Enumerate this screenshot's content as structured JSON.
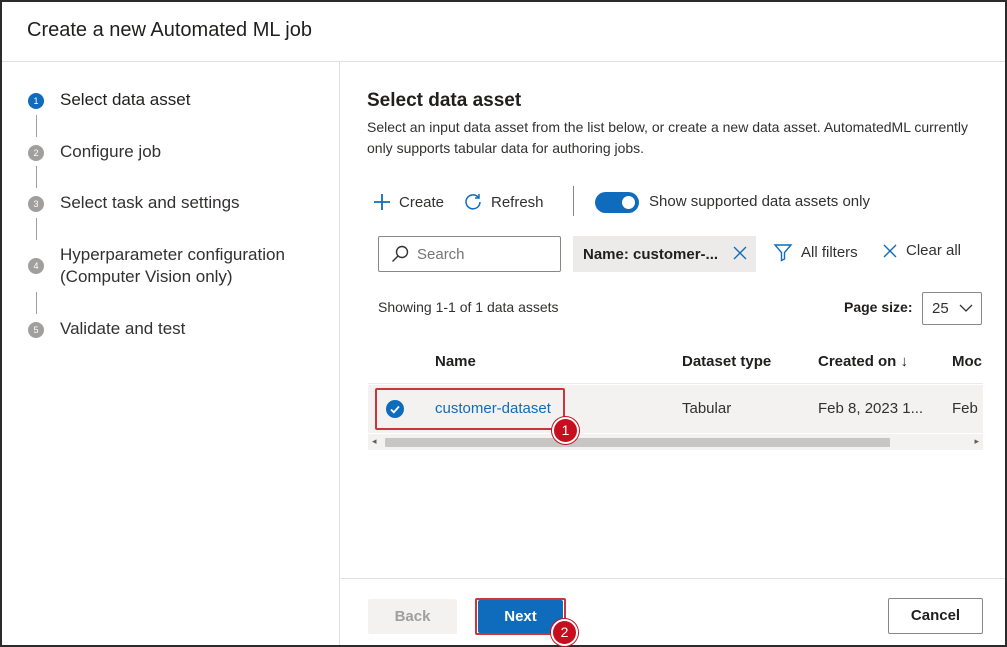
{
  "dialog": {
    "title": "Create a new Automated ML job"
  },
  "steps": [
    {
      "number": "1",
      "label": "Select data asset",
      "active": true
    },
    {
      "number": "2",
      "label": "Configure job"
    },
    {
      "number": "3",
      "label": "Select task and settings"
    },
    {
      "number": "4",
      "label": "Hyperparameter configuration",
      "label2": "(Computer Vision only)"
    },
    {
      "number": "5",
      "label": "Validate and test"
    }
  ],
  "main": {
    "title": "Select data asset",
    "description": "Select an input data asset from the list below, or create a new data asset. AutomatedML currently only supports tabular data for authoring jobs."
  },
  "toolbar": {
    "create_label": "Create",
    "refresh_label": "Refresh",
    "toggle_label": "Show supported data assets only",
    "toggle_on": true
  },
  "filters": {
    "search_placeholder": "Search",
    "chip_label": "Name: customer-...",
    "all_filters_label": "All filters",
    "clear_all_label": "Clear all"
  },
  "listing": {
    "showing_text": "Showing 1-1 of 1 data assets",
    "page_size_label": "Page size:",
    "page_size_value": "25"
  },
  "grid": {
    "columns": [
      "Name",
      "Dataset type",
      "Created on ↓",
      "Moc"
    ],
    "rows": [
      {
        "name": "customer-dataset",
        "type": "Tabular",
        "created": "Feb 8, 2023 1...",
        "modified": "Feb"
      }
    ]
  },
  "annotations": {
    "badge1": "1",
    "badge2": "2"
  },
  "footer": {
    "back_label": "Back",
    "next_label": "Next",
    "cancel_label": "Cancel"
  },
  "colors": {
    "accent": "#0f6cbd",
    "highlight": "#d13438",
    "badge": "#c50f1f"
  }
}
